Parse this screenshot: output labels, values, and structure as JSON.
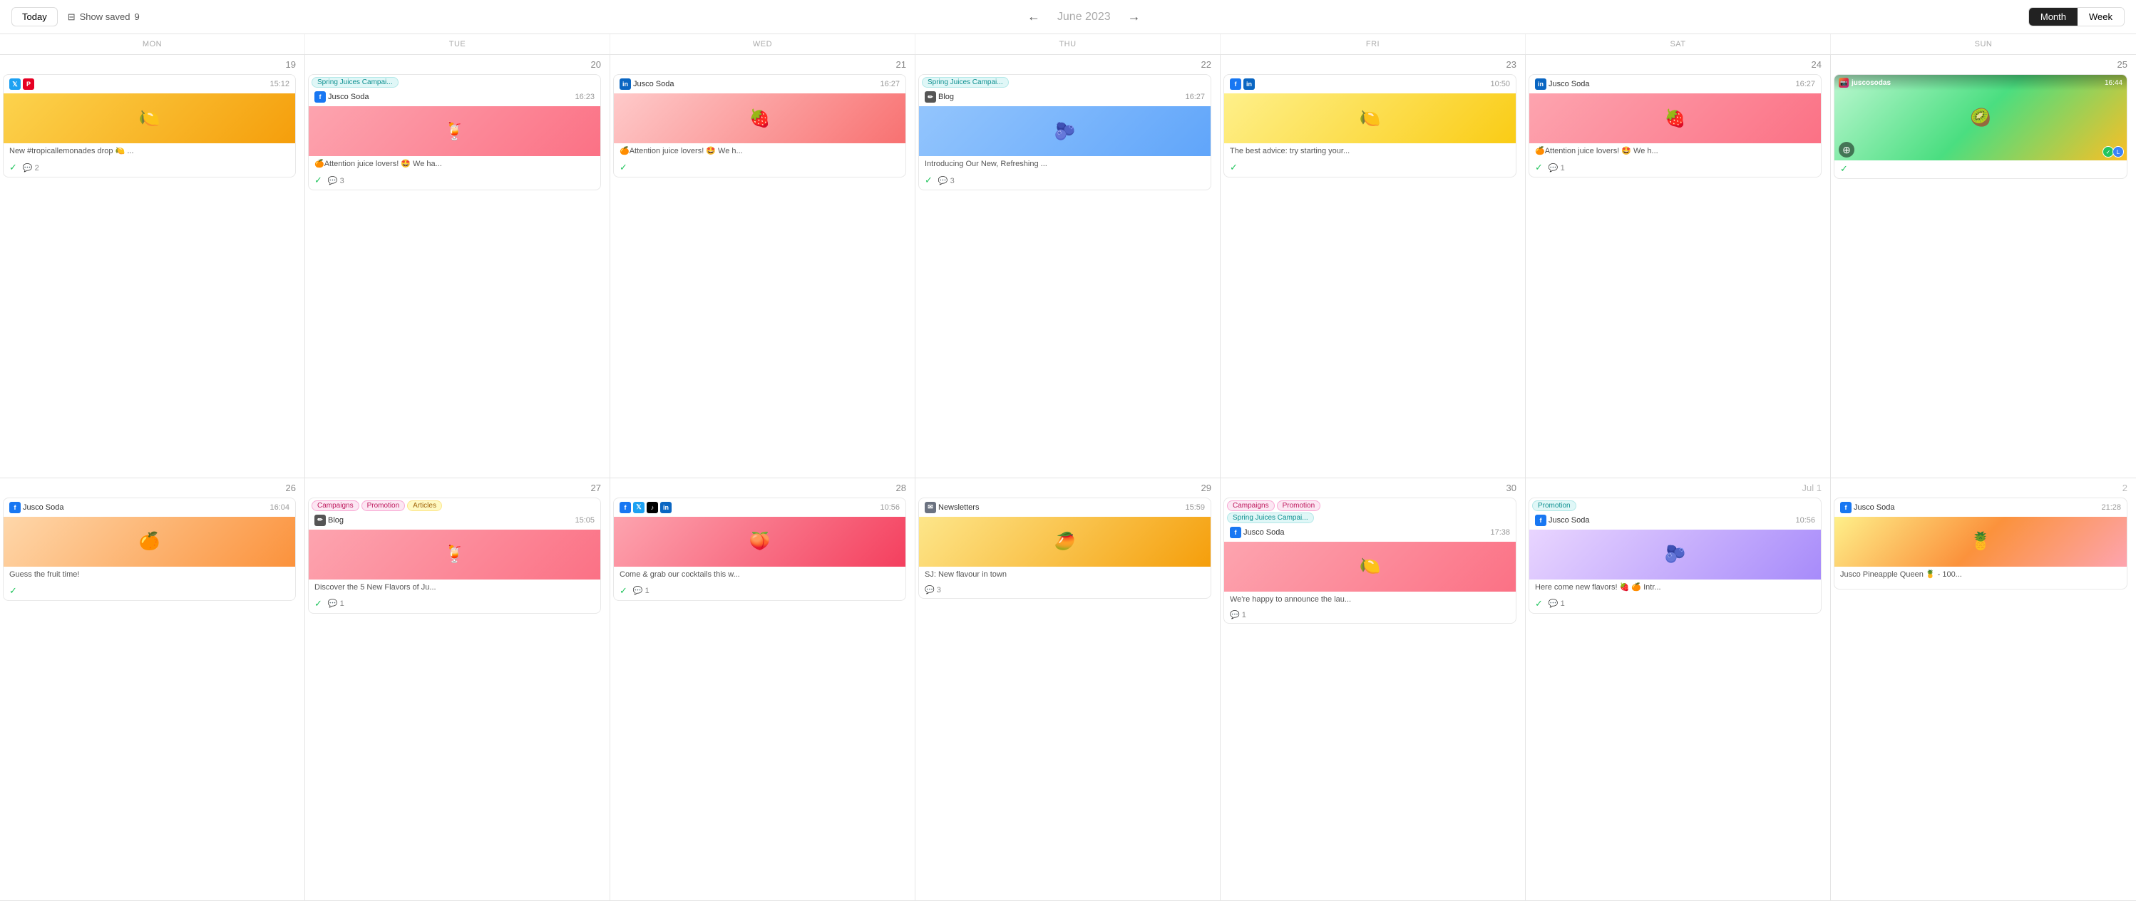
{
  "topBar": {
    "todayLabel": "Today",
    "showSavedLabel": "Show saved",
    "showSavedCount": "9",
    "navTitle": "June",
    "navYear": "2023",
    "viewMonth": "Month",
    "viewWeek": "Week",
    "activeView": "Month"
  },
  "dayHeaders": [
    "MON",
    "TUE",
    "WED",
    "THU",
    "FRI",
    "SAT",
    "SUN"
  ],
  "weeks": [
    {
      "days": [
        {
          "num": "19",
          "otherMonth": false,
          "cards": [
            {
              "id": "tw-pi-19",
              "platforms": [
                "twitter",
                "pinterest"
              ],
              "time": "15:12",
              "imageClass": "img-yellow",
              "imageEmoji": "🍋",
              "text": "New #tropicallemonades drop 🍋 ...",
              "checked": true,
              "comments": 2
            }
          ]
        },
        {
          "num": "20",
          "otherMonth": false,
          "cards": [
            {
              "id": "fb-20-1",
              "platforms": [],
              "tags": [
                {
                  "label": "Spring Juices Campai...",
                  "style": "tag-cyan"
                }
              ],
              "subPlatforms": [
                "facebook"
              ],
              "subAccount": "Jusco Soda",
              "time": "16:23",
              "imageClass": "img-pink-drink",
              "imageEmoji": "🍹",
              "text": "🍊Attention juice lovers! 🤩 We ha...",
              "checked": true,
              "comments": 3
            }
          ]
        },
        {
          "num": "21",
          "otherMonth": false,
          "cards": [
            {
              "id": "li-21",
              "platforms": [
                "linkedin"
              ],
              "account": "Jusco Soda",
              "time": "16:27",
              "imageClass": "img-strawberry",
              "imageEmoji": "🍓",
              "text": "🍊Attention juice lovers! 🤩 We h...",
              "checked": true,
              "comments": 0
            }
          ]
        },
        {
          "num": "22",
          "otherMonth": false,
          "cards": [
            {
              "id": "blog-22",
              "platforms": [],
              "tags": [
                {
                  "label": "Spring Juices Campai...",
                  "style": "tag-cyan"
                }
              ],
              "subPlatforms": [
                "blog"
              ],
              "subAccount": "Blog",
              "time": "16:27",
              "imageClass": "img-blue-drink",
              "imageEmoji": "🫐",
              "text": "Introducing Our New, Refreshing ...",
              "checked": true,
              "comments": 3
            }
          ]
        },
        {
          "num": "23",
          "otherMonth": false,
          "cards": [
            {
              "id": "fb-li-23",
              "platforms": [
                "facebook",
                "linkedin"
              ],
              "time": "10:50",
              "imageClass": "img-lemon",
              "imageEmoji": "🍋",
              "text": "The best advice: try starting your...",
              "checked": true,
              "comments": 0
            }
          ]
        },
        {
          "num": "24",
          "otherMonth": false,
          "cards": [
            {
              "id": "li-24",
              "platforms": [
                "linkedin"
              ],
              "account": "Jusco Soda",
              "time": "16:27",
              "imageClass": "img-pink-drink",
              "imageEmoji": "🍓",
              "text": "🍊Attention juice lovers! 🤩 We h...",
              "checked": true,
              "comments": 1
            }
          ]
        },
        {
          "num": "25",
          "otherMonth": false,
          "cards": [
            {
              "id": "ig-25",
              "isInstagram": true,
              "account": "juscosodas",
              "time": "16:44",
              "imageClass": "img-fruit-mix",
              "imageEmoji": "🥝",
              "avatars": [
                "green",
                "blue"
              ],
              "checked": true
            }
          ]
        }
      ]
    },
    {
      "days": [
        {
          "num": "26",
          "otherMonth": false,
          "cards": [
            {
              "id": "fb-26",
              "platforms": [
                "facebook"
              ],
              "account": "Jusco Soda",
              "time": "16:04",
              "imageClass": "img-orange",
              "imageEmoji": "🍊",
              "text": "Guess the fruit time!",
              "checked": true,
              "comments": 0
            }
          ]
        },
        {
          "num": "27",
          "otherMonth": false,
          "cards": [
            {
              "id": "multi-27",
              "platforms": [],
              "tags": [
                {
                  "label": "Campaigns",
                  "style": "tag-pink"
                },
                {
                  "label": "Promotion",
                  "style": "tag-pink"
                },
                {
                  "label": "Articles",
                  "style": "tag-yellow"
                }
              ],
              "subPlatforms": [
                "blog"
              ],
              "subAccount": "Blog",
              "time": "15:05",
              "imageClass": "img-pink-drink",
              "imageEmoji": "🍹",
              "text": "Discover the 5 New Flavors of Ju...",
              "checked": true,
              "comments": 1
            }
          ]
        },
        {
          "num": "28",
          "otherMonth": false,
          "cards": [
            {
              "id": "fb-tw-28",
              "platforms": [
                "facebook",
                "twitter",
                "tiktok",
                "linkedin"
              ],
              "time": "10:56",
              "imageClass": "img-grapefruit",
              "imageEmoji": "🍑",
              "text": "Come & grab our cocktails this w...",
              "checked": true,
              "comments": 1
            }
          ]
        },
        {
          "num": "29",
          "otherMonth": false,
          "cards": [
            {
              "id": "nl-29",
              "platforms": [
                "email"
              ],
              "account": "Newsletters",
              "time": "15:59",
              "imageClass": "img-mango",
              "imageEmoji": "🥭",
              "text": "SJ: New flavour in town",
              "checked": false,
              "comments": 3
            }
          ]
        },
        {
          "num": "30",
          "otherMonth": false,
          "cards": [
            {
              "id": "multi-30",
              "platforms": [],
              "tags": [
                {
                  "label": "Campaigns",
                  "style": "tag-pink"
                },
                {
                  "label": "Promotion",
                  "style": "tag-pink"
                },
                {
                  "label": "Spring Juices Campai...",
                  "style": "tag-cyan"
                }
              ],
              "subPlatforms": [
                "facebook"
              ],
              "subAccount": "Jusco Soda",
              "time": "17:38",
              "imageClass": "img-pink-drink",
              "imageEmoji": "🍋",
              "text": "We're happy to announce the lau...",
              "checked": false,
              "comments": 1
            }
          ]
        },
        {
          "num": "Jul 1",
          "otherMonth": true,
          "cards": [
            {
              "id": "promo-jul1",
              "platforms": [],
              "tags": [
                {
                  "label": "Promotion",
                  "style": "tag-cyan"
                }
              ],
              "subPlatforms": [
                "facebook"
              ],
              "subAccount": "Jusco Soda",
              "time": "10:56",
              "imageClass": "img-berry",
              "imageEmoji": "🫐",
              "text": "Here come new flavors! 🍓 🍊 Intr...",
              "checked": true,
              "comments": 1
            }
          ]
        },
        {
          "num": "2",
          "otherMonth": true,
          "cards": [
            {
              "id": "fb-jul2",
              "platforms": [
                "facebook"
              ],
              "account": "Jusco Soda",
              "time": "21:28",
              "imageClass": "img-pineapple",
              "imageEmoji": "🍍",
              "text": "Jusco Pineapple Queen 🍍 - 100...",
              "checked": false,
              "comments": 0
            }
          ]
        }
      ]
    }
  ],
  "icons": {
    "twitter": "𝕏",
    "pinterest": "P",
    "facebook": "f",
    "linkedin": "in",
    "blog": "✏",
    "instagram": "📷",
    "email": "✉",
    "tiktok": "♪",
    "arrowLeft": "←",
    "arrowRight": "→",
    "check": "✓",
    "comment": "💬",
    "plus": "+",
    "bookmark": "⊟"
  }
}
